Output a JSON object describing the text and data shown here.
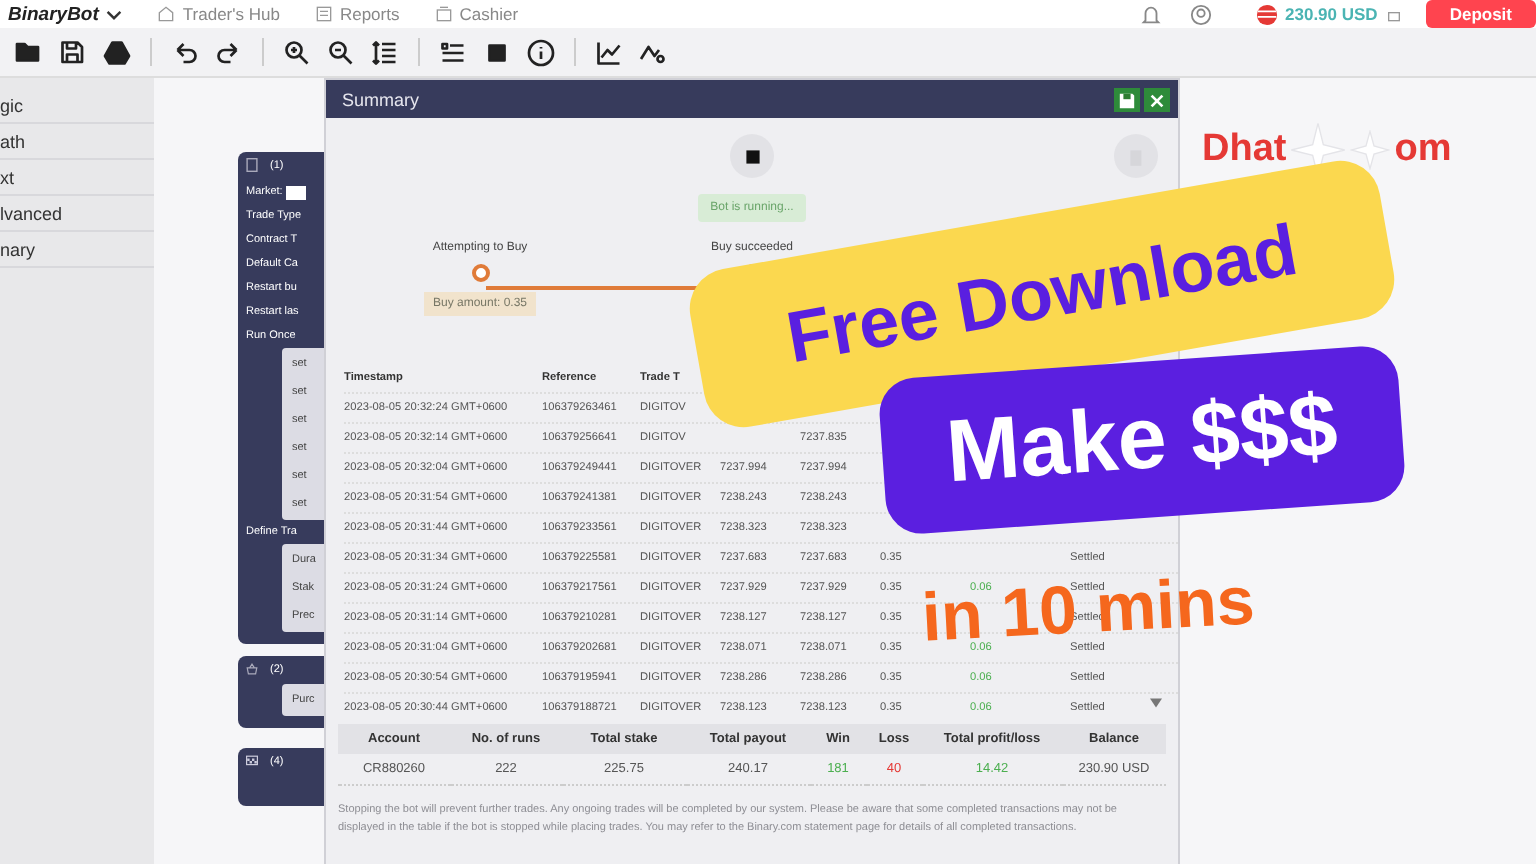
{
  "header": {
    "logo": "BinaryBot",
    "nav": [
      {
        "label": "Trader's Hub"
      },
      {
        "label": "Reports"
      },
      {
        "label": "Cashier"
      }
    ],
    "balance": "230.90 USD",
    "deposit": "Deposit"
  },
  "sidebar": {
    "items": [
      {
        "label": "gic",
        "selected": false
      },
      {
        "label": "ath",
        "selected": false
      },
      {
        "label": "xt",
        "selected": false
      },
      {
        "label": "lvanced",
        "selected": false
      },
      {
        "label": "nary",
        "selected": false
      }
    ]
  },
  "blocks": [
    {
      "number": "(1)",
      "rows": [
        {
          "kind": "field",
          "text": "Market:"
        },
        {
          "kind": "label",
          "text": "Trade Type"
        },
        {
          "kind": "label",
          "text": "Contract T"
        },
        {
          "kind": "label",
          "text": "Default Ca"
        },
        {
          "kind": "label",
          "text": "Restart bu"
        },
        {
          "kind": "label",
          "text": "Restart las"
        },
        {
          "kind": "label",
          "text": "Run Once"
        },
        {
          "kind": "inner",
          "items": [
            "set",
            "set",
            "set",
            "set",
            "set",
            "set"
          ]
        },
        {
          "kind": "label",
          "text": "Define Tra"
        },
        {
          "kind": "inner",
          "items": [
            "Dura",
            "Stak",
            "Prec"
          ]
        }
      ]
    },
    {
      "number": "(2)",
      "rows": [
        {
          "kind": "inner",
          "items": [
            "Purc"
          ]
        }
      ]
    },
    {
      "number": "(4)"
    }
  ],
  "summary": {
    "title": "Summary",
    "status": "Bot is running...",
    "timeline": {
      "left_label": "Attempting to Buy",
      "right_label": "Buy succeeded",
      "tooltip": "Buy amount: 0.35"
    },
    "table": {
      "columns": [
        "Timestamp",
        "Reference",
        "Trade T"
      ],
      "rows": [
        {
          "timestamp": "2023-08-05 20:32:24 GMT+0600",
          "reference": "106379263461",
          "trade_type": "DIGITOV"
        },
        {
          "timestamp": "2023-08-05 20:32:14 GMT+0600",
          "reference": "106379256641",
          "trade_type": "DIGITOV",
          "exit_spot": "7237.835"
        },
        {
          "timestamp": "2023-08-05 20:32:04 GMT+0600",
          "reference": "106379249441",
          "trade_type": "DIGITOVER",
          "entry_spot": "7237.994",
          "exit_spot": "7237.994"
        },
        {
          "timestamp": "2023-08-05 20:31:54 GMT+0600",
          "reference": "106379241381",
          "trade_type": "DIGITOVER",
          "entry_spot": "7238.243",
          "exit_spot": "7238.243"
        },
        {
          "timestamp": "2023-08-05 20:31:44 GMT+0600",
          "reference": "106379233561",
          "trade_type": "DIGITOVER",
          "entry_spot": "7238.323",
          "exit_spot": "7238.323"
        },
        {
          "timestamp": "2023-08-05 20:31:34 GMT+0600",
          "reference": "106379225581",
          "trade_type": "DIGITOVER",
          "entry_spot": "7237.683",
          "exit_spot": "7237.683",
          "buy_price": "0.35",
          "status": "Settled"
        },
        {
          "timestamp": "2023-08-05 20:31:24 GMT+0600",
          "reference": "106379217561",
          "trade_type": "DIGITOVER",
          "entry_spot": "7237.929",
          "exit_spot": "7237.929",
          "buy_price": "0.35",
          "profit": "0.06",
          "status": "Settled"
        },
        {
          "timestamp": "2023-08-05 20:31:14 GMT+0600",
          "reference": "106379210281",
          "trade_type": "DIGITOVER",
          "entry_spot": "7238.127",
          "exit_spot": "7238.127",
          "buy_price": "0.35",
          "status": "Settled"
        },
        {
          "timestamp": "2023-08-05 20:31:04 GMT+0600",
          "reference": "106379202681",
          "trade_type": "DIGITOVER",
          "entry_spot": "7238.071",
          "exit_spot": "7238.071",
          "buy_price": "0.35",
          "profit": "0.06",
          "status": "Settled"
        },
        {
          "timestamp": "2023-08-05 20:30:54 GMT+0600",
          "reference": "106379195941",
          "trade_type": "DIGITOVER",
          "entry_spot": "7238.286",
          "exit_spot": "7238.286",
          "buy_price": "0.35",
          "profit": "0.06",
          "status": "Settled"
        },
        {
          "timestamp": "2023-08-05 20:30:44 GMT+0600",
          "reference": "106379188721",
          "trade_type": "DIGITOVER",
          "entry_spot": "7238.123",
          "exit_spot": "7238.123",
          "buy_price": "0.35",
          "profit": "0.06",
          "status": "Settled"
        }
      ]
    },
    "stats": [
      {
        "label": "Account",
        "value": "CR880260",
        "color": "#555555"
      },
      {
        "label": "No. of runs",
        "value": "222",
        "color": "#555555"
      },
      {
        "label": "Total stake",
        "value": "225.75",
        "color": "#555555"
      },
      {
        "label": "Total payout",
        "value": "240.17",
        "color": "#555555"
      },
      {
        "label": "Win",
        "value": "181",
        "color": "#4caf50"
      },
      {
        "label": "Loss",
        "value": "40",
        "color": "#e53935"
      },
      {
        "label": "Total profit/loss",
        "value": "14.42",
        "color": "#4caf50"
      },
      {
        "label": "Balance",
        "value": "230.90 USD",
        "color": "#555555"
      }
    ],
    "disclaimer": "Stopping the bot will prevent further trades. Any ongoing trades will be completed by our system. Please be aware that some completed transactions may not be displayed in the table if the bot is stopped while placing trades. You may refer to the Binary.com statement page for details of all completed transactions."
  },
  "brand_text": [
    "Dhat",
    "om"
  ],
  "promo": {
    "banner": "Free Download",
    "badge": "Make $$$",
    "caption": "in 10 mins"
  }
}
